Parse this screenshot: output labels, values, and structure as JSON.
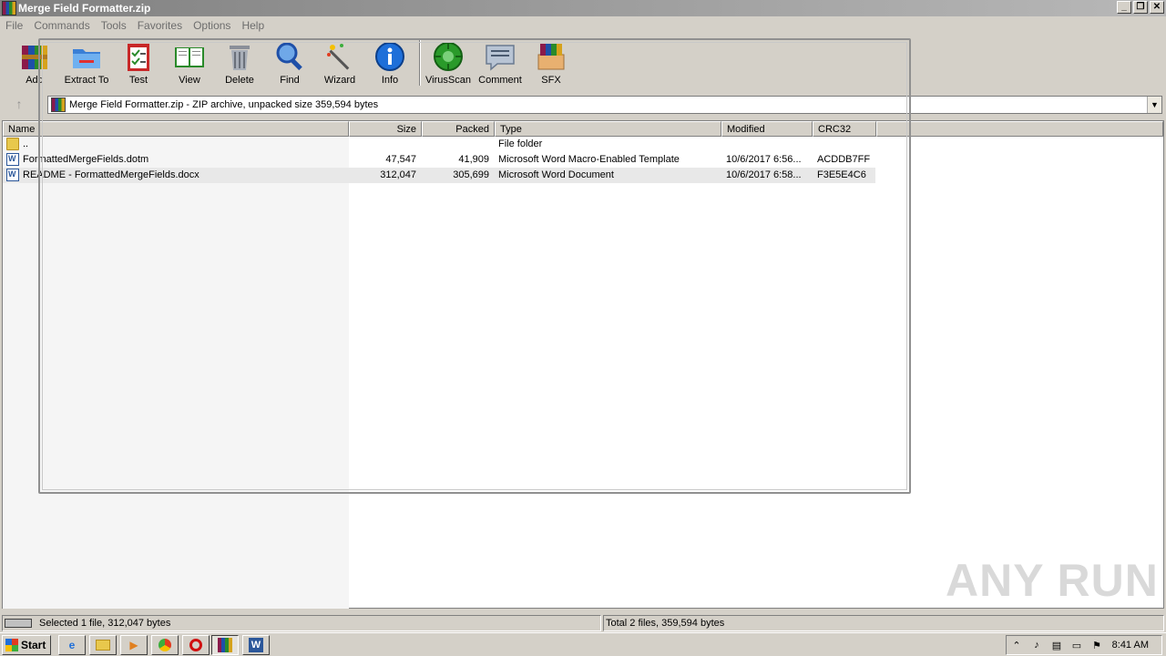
{
  "window": {
    "title": "Merge Field Formatter.zip",
    "buttons": [
      "_",
      "❐",
      "✕"
    ]
  },
  "menu": [
    "File",
    "Commands",
    "Tools",
    "Favorites",
    "Options",
    "Help"
  ],
  "toolbar": {
    "buttons": [
      {
        "label": "Add",
        "icon": "add-archive-icon"
      },
      {
        "label": "Extract To",
        "icon": "extract-folder-icon"
      },
      {
        "label": "Test",
        "icon": "test-checklist-icon"
      },
      {
        "label": "View",
        "icon": "view-book-icon"
      },
      {
        "label": "Delete",
        "icon": "trash-icon"
      },
      {
        "label": "Find",
        "icon": "magnifier-icon"
      },
      {
        "label": "Wizard",
        "icon": "wand-icon"
      },
      {
        "label": "Info",
        "icon": "info-icon"
      },
      {
        "label": "VirusScan",
        "icon": "virus-scan-icon"
      },
      {
        "label": "Comment",
        "icon": "comment-icon"
      },
      {
        "label": "SFX",
        "icon": "sfx-box-icon"
      }
    ]
  },
  "address": {
    "text": "Merge Field Formatter.zip - ZIP archive, unpacked size 359,594 bytes"
  },
  "columns": [
    "Name",
    "Size",
    "Packed",
    "Type",
    "Modified",
    "CRC32"
  ],
  "rows": [
    {
      "name": "..",
      "size": "",
      "packed": "",
      "type": "File folder",
      "modified": "",
      "crc": "",
      "icon": "folder-icon"
    },
    {
      "name": "FormattedMergeFields.dotm",
      "size": "47,547",
      "packed": "41,909",
      "type": "Microsoft Word Macro-Enabled Template",
      "modified": "10/6/2017 6:56...",
      "crc": "ACDDB7FF",
      "icon": "word-doc-icon"
    },
    {
      "name": "README - FormattedMergeFields.docx",
      "size": "312,047",
      "packed": "305,699",
      "type": "Microsoft Word Document",
      "modified": "10/6/2017 6:58...",
      "crc": "F3E5E4C6",
      "icon": "word-doc-icon",
      "selected": true
    }
  ],
  "status": {
    "left": "Selected 1 file, 312,047 bytes",
    "right": "Total 2 files, 359,594 bytes"
  },
  "watermark": "ANY RUN",
  "taskbar": {
    "start": "Start",
    "clock": "8:41 AM"
  }
}
